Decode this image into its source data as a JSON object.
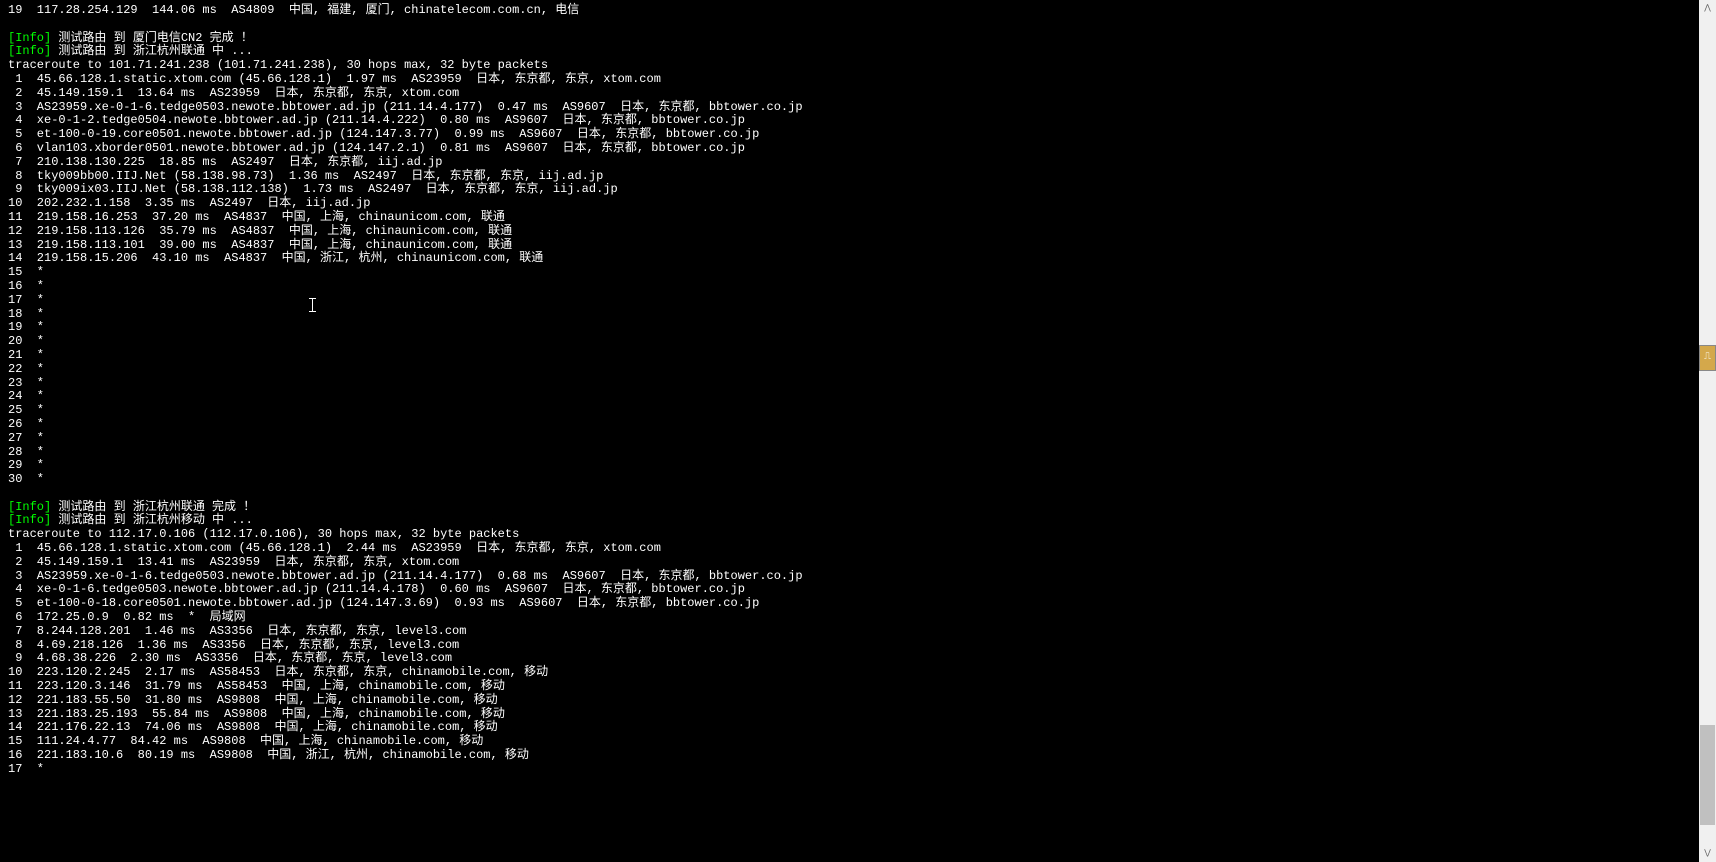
{
  "lines": [
    {
      "type": "plain",
      "text": "19  117.28.254.129  144.06 ms  AS4809  中国, 福建, 厦门, chinatelecom.com.cn, 电信"
    },
    {
      "type": "blank",
      "text": ""
    },
    {
      "type": "info",
      "prefix": "[Info]",
      "text": " 测试路由 到 厦门电信CN2 完成 ！"
    },
    {
      "type": "info",
      "prefix": "[Info]",
      "text": " 测试路由 到 浙江杭州联通 中 ..."
    },
    {
      "type": "plain",
      "text": "traceroute to 101.71.241.238 (101.71.241.238), 30 hops max, 32 byte packets"
    },
    {
      "type": "plain",
      "text": " 1  45.66.128.1.static.xtom.com (45.66.128.1)  1.97 ms  AS23959  日本, 东京都, 东京, xtom.com"
    },
    {
      "type": "plain",
      "text": " 2  45.149.159.1  13.64 ms  AS23959  日本, 东京都, 东京, xtom.com"
    },
    {
      "type": "plain",
      "text": " 3  AS23959.xe-0-1-6.tedge0503.newote.bbtower.ad.jp (211.14.4.177)  0.47 ms  AS9607  日本, 东京都, bbtower.co.jp"
    },
    {
      "type": "plain",
      "text": " 4  xe-0-1-2.tedge0504.newote.bbtower.ad.jp (211.14.4.222)  0.80 ms  AS9607  日本, 东京都, bbtower.co.jp"
    },
    {
      "type": "plain",
      "text": " 5  et-100-0-19.core0501.newote.bbtower.ad.jp (124.147.3.77)  0.99 ms  AS9607  日本, 东京都, bbtower.co.jp"
    },
    {
      "type": "plain",
      "text": " 6  vlan103.xborder0501.newote.bbtower.ad.jp (124.147.2.1)  0.81 ms  AS9607  日本, 东京都, bbtower.co.jp"
    },
    {
      "type": "plain",
      "text": " 7  210.138.130.225  18.85 ms  AS2497  日本, 东京都, iij.ad.jp"
    },
    {
      "type": "plain",
      "text": " 8  tky009bb00.IIJ.Net (58.138.98.73)  1.36 ms  AS2497  日本, 东京都, 东京, iij.ad.jp"
    },
    {
      "type": "plain",
      "text": " 9  tky009ix03.IIJ.Net (58.138.112.138)  1.73 ms  AS2497  日本, 东京都, 东京, iij.ad.jp"
    },
    {
      "type": "plain",
      "text": "10  202.232.1.158  3.35 ms  AS2497  日本, iij.ad.jp"
    },
    {
      "type": "plain",
      "text": "11  219.158.16.253  37.20 ms  AS4837  中国, 上海, chinaunicom.com, 联通"
    },
    {
      "type": "plain",
      "text": "12  219.158.113.126  35.79 ms  AS4837  中国, 上海, chinaunicom.com, 联通"
    },
    {
      "type": "plain",
      "text": "13  219.158.113.101  39.00 ms  AS4837  中国, 上海, chinaunicom.com, 联通"
    },
    {
      "type": "plain",
      "text": "14  219.158.15.206  43.10 ms  AS4837  中国, 浙江, 杭州, chinaunicom.com, 联通"
    },
    {
      "type": "plain",
      "text": "15  *"
    },
    {
      "type": "plain",
      "text": "16  *"
    },
    {
      "type": "plain",
      "text": "17  *"
    },
    {
      "type": "plain",
      "text": "18  *"
    },
    {
      "type": "plain",
      "text": "19  *"
    },
    {
      "type": "plain",
      "text": "20  *"
    },
    {
      "type": "plain",
      "text": "21  *"
    },
    {
      "type": "plain",
      "text": "22  *"
    },
    {
      "type": "plain",
      "text": "23  *"
    },
    {
      "type": "plain",
      "text": "24  *"
    },
    {
      "type": "plain",
      "text": "25  *"
    },
    {
      "type": "plain",
      "text": "26  *"
    },
    {
      "type": "plain",
      "text": "27  *"
    },
    {
      "type": "plain",
      "text": "28  *"
    },
    {
      "type": "plain",
      "text": "29  *"
    },
    {
      "type": "plain",
      "text": "30  *"
    },
    {
      "type": "blank",
      "text": ""
    },
    {
      "type": "info",
      "prefix": "[Info]",
      "text": " 测试路由 到 浙江杭州联通 完成 ！"
    },
    {
      "type": "info",
      "prefix": "[Info]",
      "text": " 测试路由 到 浙江杭州移动 中 ..."
    },
    {
      "type": "plain",
      "text": "traceroute to 112.17.0.106 (112.17.0.106), 30 hops max, 32 byte packets"
    },
    {
      "type": "plain",
      "text": " 1  45.66.128.1.static.xtom.com (45.66.128.1)  2.44 ms  AS23959  日本, 东京都, 东京, xtom.com"
    },
    {
      "type": "plain",
      "text": " 2  45.149.159.1  13.41 ms  AS23959  日本, 东京都, 东京, xtom.com"
    },
    {
      "type": "plain",
      "text": " 3  AS23959.xe-0-1-6.tedge0503.newote.bbtower.ad.jp (211.14.4.177)  0.68 ms  AS9607  日本, 东京都, bbtower.co.jp"
    },
    {
      "type": "plain",
      "text": " 4  xe-0-1-6.tedge0503.newote.bbtower.ad.jp (211.14.4.178)  0.60 ms  AS9607  日本, 东京都, bbtower.co.jp"
    },
    {
      "type": "plain",
      "text": " 5  et-100-0-18.core0501.newote.bbtower.ad.jp (124.147.3.69)  0.93 ms  AS9607  日本, 东京都, bbtower.co.jp"
    },
    {
      "type": "plain",
      "text": " 6  172.25.0.9  0.82 ms  *  局域网"
    },
    {
      "type": "plain",
      "text": " 7  8.244.128.201  1.46 ms  AS3356  日本, 东京都, 东京, level3.com"
    },
    {
      "type": "plain",
      "text": " 8  4.69.218.126  1.36 ms  AS3356  日本, 东京都, 东京, level3.com"
    },
    {
      "type": "plain",
      "text": " 9  4.68.38.226  2.30 ms  AS3356  日本, 东京都, 东京, level3.com"
    },
    {
      "type": "plain",
      "text": "10  223.120.2.245  2.17 ms  AS58453  日本, 东京都, 东京, chinamobile.com, 移动"
    },
    {
      "type": "plain",
      "text": "11  223.120.3.146  31.79 ms  AS58453  中国, 上海, chinamobile.com, 移动"
    },
    {
      "type": "plain",
      "text": "12  221.183.55.50  31.80 ms  AS9808  中国, 上海, chinamobile.com, 移动"
    },
    {
      "type": "plain",
      "text": "13  221.183.25.193  55.84 ms  AS9808  中国, 上海, chinamobile.com, 移动"
    },
    {
      "type": "plain",
      "text": "14  221.176.22.13  74.06 ms  AS9808  中国, 上海, chinamobile.com, 移动"
    },
    {
      "type": "plain",
      "text": "15  111.24.4.77  84.42 ms  AS9808  中国, 上海, chinamobile.com, 移动"
    },
    {
      "type": "plain",
      "text": "16  221.183.10.6  80.19 ms  AS9808  中国, 浙江, 杭州, chinamobile.com, 移动"
    },
    {
      "type": "plain",
      "text": "17  *"
    }
  ],
  "scrollbar": {
    "up": "⋀",
    "down": "⋁"
  },
  "usb": "⎍"
}
